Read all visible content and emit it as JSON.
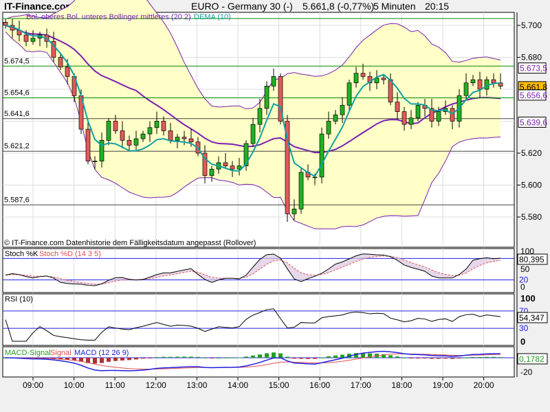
{
  "header": {
    "site": "IT-Finance.com",
    "instrument": "EURO - Germany 30 (-)",
    "quote": "5.661,8 (-0,77%)",
    "interval": "5 Minuten",
    "time": "20:15"
  },
  "legend": {
    "bollinger": "Bol. oberes Bol. unteres Bollinger mittleres (20 2)",
    "dema": "DEMA (10)",
    "copyright": "© IT-Finance.com Datenhistorie dem Fälligkeitsdatum angepasst (Rollover)",
    "stoch_k": "Stoch %K",
    "stoch_d": "Stoch %D (14 3 5)",
    "rsi": "RSI (10)",
    "macd_signal_hist": "MACD-Signal",
    "macd_signal": "Signal",
    "macd": "MACD (12 26 9)"
  },
  "colors": {
    "up": "#22b022",
    "down": "#e05a5a",
    "band_fill": "#ffffc8",
    "band": "#7a1fb0",
    "dema": "#10a0a0",
    "level": "#008800",
    "blue": "#2020e0"
  },
  "chart_data": {
    "type": "candlestick",
    "candle_minutes": 10,
    "start_time": "08:40",
    "closes": [
      5700,
      5697,
      5694,
      5690,
      5692,
      5694,
      5690,
      5680,
      5674,
      5668,
      5656,
      5635,
      5615,
      5615,
      5628,
      5640,
      5634,
      5628,
      5625,
      5629,
      5632,
      5636,
      5640,
      5634,
      5628,
      5630,
      5629,
      5627,
      5620,
      5606,
      5610,
      5614,
      5612,
      5610,
      5612,
      5626,
      5638,
      5648,
      5662,
      5668,
      5640,
      5582,
      5585,
      5608,
      5605,
      5605,
      5632,
      5640,
      5644,
      5650,
      5664,
      5670,
      5668,
      5664,
      5667,
      5666,
      5652,
      5646,
      5638,
      5642,
      5650,
      5648,
      5640,
      5646,
      5648,
      5640,
      5656,
      5664,
      5666,
      5660,
      5666,
      5664,
      5662
    ],
    "price_ticks": [
      "5.700",
      "5.680",
      "5.620",
      "5.600",
      "5.580"
    ],
    "price_tick_values": [
      5700,
      5680,
      5620,
      5600,
      5580
    ],
    "levels": [
      {
        "label": "5.674,5",
        "value": 5674.5
      },
      {
        "label": "5.654,6",
        "value": 5654.6
      },
      {
        "label": "5.641,6",
        "value": 5641.6
      },
      {
        "label": "5.621,2",
        "value": 5621.2
      },
      {
        "label": "5.587,6",
        "value": 5587.6
      }
    ],
    "right_labels": [
      {
        "text": "5.673,5",
        "value": 5673.5,
        "kind": "band"
      },
      {
        "text": "5.661,8",
        "value": 5661.8,
        "kind": "last"
      },
      {
        "text": "5.656,6",
        "value": 5656.6,
        "kind": "band"
      },
      {
        "text": "5.639,6",
        "value": 5639.6,
        "kind": "band"
      }
    ],
    "time_ticks": [
      "09:00",
      "10:00",
      "11:00",
      "12:00",
      "13:00",
      "14:00",
      "15:00",
      "16:00",
      "17:00",
      "18:00",
      "19:00",
      "20:00"
    ],
    "stoch": {
      "ticks": [
        "100",
        "50",
        "0"
      ],
      "last": "80,395",
      "level": "20"
    },
    "rsi": {
      "ticks": [
        "100",
        "0"
      ],
      "last": "54,347",
      "levels": [
        "70",
        "30"
      ]
    },
    "macd": {
      "last": "0,1782",
      "ticks": [
        "-20"
      ]
    }
  }
}
